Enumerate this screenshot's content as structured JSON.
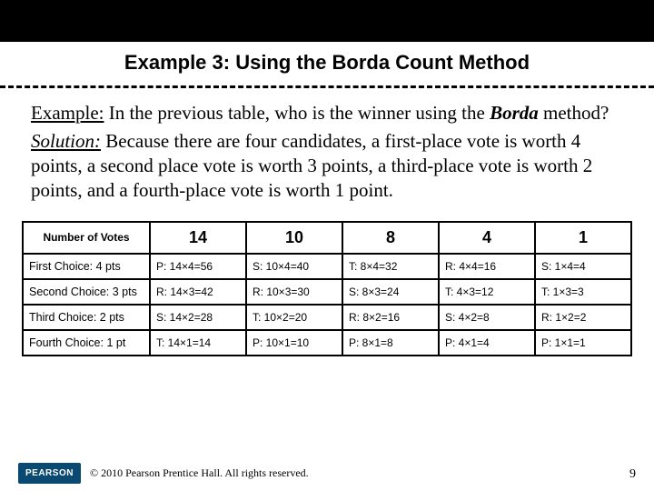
{
  "title": "Example 3: Using the Borda Count Method",
  "paragraphs": {
    "example_label": "Example:",
    "example_text": " In the previous table, who is the winner using the ",
    "borda_word": "Borda",
    "example_tail": " method?",
    "solution_label": "Solution:",
    "solution_text": " Because there are four candidates, a first-place vote is worth 4 points, a second place vote is worth 3 points, a third-place vote is worth 2 points, and a fourth-place vote is worth 1 point."
  },
  "chart_data": {
    "type": "table",
    "header_label": "Number of Votes",
    "columns": [
      "14",
      "10",
      "8",
      "4",
      "1"
    ],
    "rows": [
      {
        "label": "First Choice: 4 pts",
        "cells": [
          "P: 14×4=56",
          "S: 10×4=40",
          "T: 8×4=32",
          "R: 4×4=16",
          "S: 1×4=4"
        ]
      },
      {
        "label": "Second Choice: 3 pts",
        "cells": [
          "R: 14×3=42",
          "R: 10×3=30",
          "S: 8×3=24",
          "T: 4×3=12",
          "T: 1×3=3"
        ]
      },
      {
        "label": "Third Choice: 2 pts",
        "cells": [
          "S: 14×2=28",
          "T: 10×2=20",
          "R: 8×2=16",
          "S: 4×2=8",
          "R: 1×2=2"
        ]
      },
      {
        "label": "Fourth Choice: 1 pt",
        "cells": [
          "T: 14×1=14",
          "P: 10×1=10",
          "P: 8×1=8",
          "P: 4×1=4",
          "P: 1×1=1"
        ]
      }
    ]
  },
  "footer": {
    "logo": "PEARSON",
    "copyright": "© 2010 Pearson Prentice Hall. All rights reserved.",
    "page": "9"
  }
}
